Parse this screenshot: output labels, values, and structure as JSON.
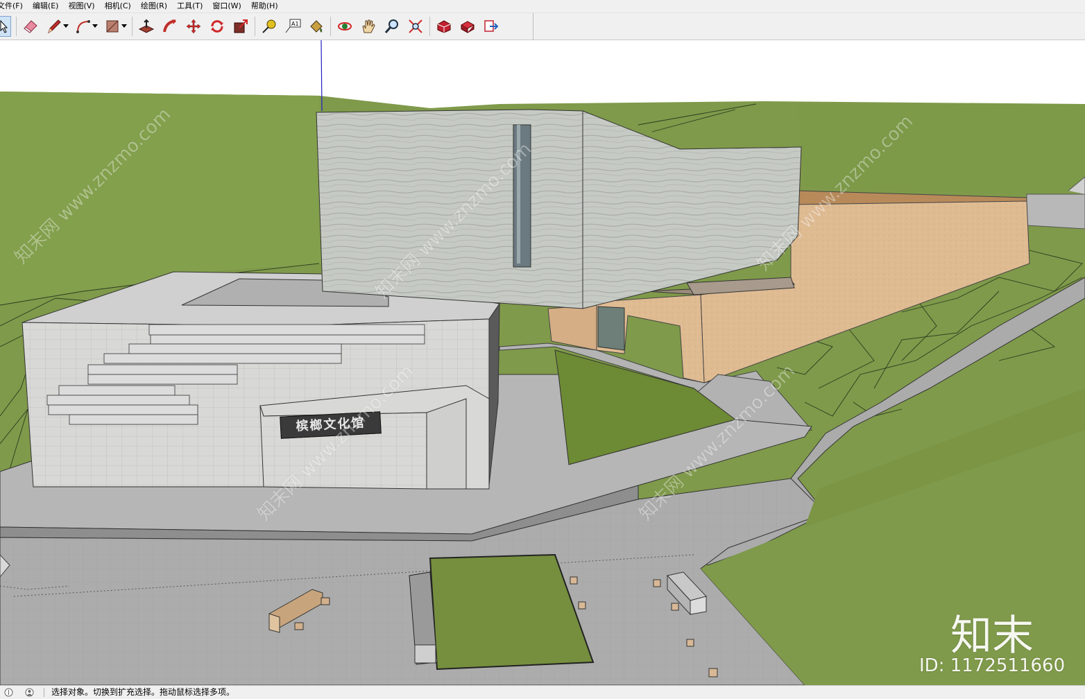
{
  "menu": {
    "items": [
      "文件(F)",
      "编辑(E)",
      "视图(V)",
      "相机(C)",
      "绘图(R)",
      "工具(T)",
      "窗口(W)",
      "帮助(H)"
    ]
  },
  "toolbar": {
    "tools": [
      {
        "name": "select-tool",
        "icon": "arrow-cursor-icon"
      },
      {
        "name": "eraser-tool",
        "icon": "eraser-icon"
      },
      {
        "name": "line-tool",
        "icon": "pencil-icon"
      },
      {
        "name": "arc-tool",
        "icon": "arc-icon"
      },
      {
        "name": "rectangle-tool",
        "icon": "rectangle-icon"
      },
      {
        "name": "push-pull-tool",
        "icon": "push-pull-icon"
      },
      {
        "name": "follow-me-tool",
        "icon": "follow-me-icon"
      },
      {
        "name": "move-tool",
        "icon": "move-icon"
      },
      {
        "name": "rotate-tool",
        "icon": "rotate-icon"
      },
      {
        "name": "scale-tool",
        "icon": "scale-icon"
      },
      {
        "name": "tape-measure-tool",
        "icon": "tape-measure-icon"
      },
      {
        "name": "text-tool",
        "icon": "text-label-icon"
      },
      {
        "name": "paint-bucket-tool",
        "icon": "paint-bucket-icon"
      },
      {
        "name": "orbit-tool",
        "icon": "orbit-icon"
      },
      {
        "name": "pan-tool",
        "icon": "hand-icon"
      },
      {
        "name": "zoom-tool",
        "icon": "magnifier-icon"
      },
      {
        "name": "zoom-extents-tool",
        "icon": "zoom-extents-icon"
      },
      {
        "name": "warehouse-tool",
        "icon": "3d-warehouse-icon"
      },
      {
        "name": "extension-warehouse-tool",
        "icon": "extension-warehouse-icon"
      },
      {
        "name": "layout-tool",
        "icon": "send-to-layout-icon"
      }
    ],
    "text_tool_label": "A1"
  },
  "scene": {
    "building_sign": "槟榔文化馆",
    "colors": {
      "sky": "#ffffff",
      "grass": "#7f9a4a",
      "grass_dark": "#6a8a35",
      "pavement": "#a9a9a9",
      "stone": "#c8cbc6",
      "sand": "#d9b38a",
      "axis_blue": "#2020c0"
    }
  },
  "status": {
    "text": "选择对象。切换到扩充选择。拖动鼠标选择多项。"
  },
  "watermark": {
    "site": "知末网 www.znzmo.com",
    "brand": "知末",
    "id": "ID: 1172511660"
  }
}
